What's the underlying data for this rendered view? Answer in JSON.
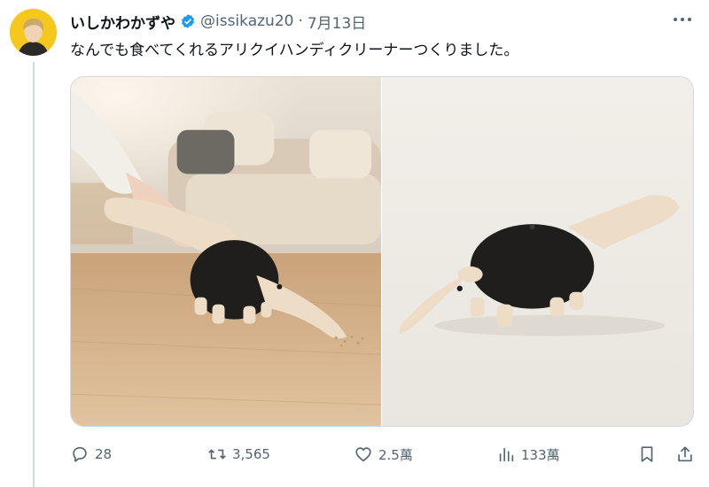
{
  "tweet": {
    "display_name": "いしかわかずや",
    "handle": "@issikazu20",
    "separator": "·",
    "date": "7月13日",
    "text": "なんでも食べてくれるアリクイハンディクリーナーつくりました。"
  },
  "icons": {
    "verified": "verified-badge-icon",
    "more": "more-icon",
    "reply": "reply-icon",
    "retweet": "retweet-icon",
    "like": "heart-icon",
    "views": "views-icon",
    "bookmark": "bookmark-icon",
    "share": "share-icon"
  },
  "metrics": {
    "replies": "28",
    "retweets": "3,565",
    "likes": "2.5萬",
    "views": "133萬"
  },
  "colors": {
    "verified": "#1d9bf0",
    "secondary_text": "#536471",
    "avatar_bg": "#f6c81e"
  }
}
